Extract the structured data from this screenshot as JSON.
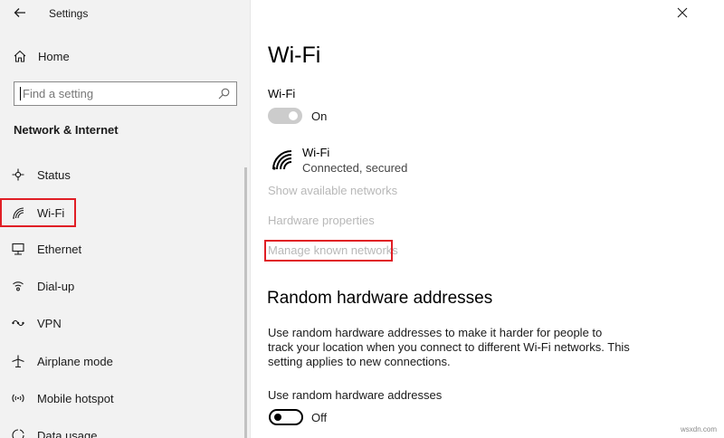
{
  "window": {
    "title": "Settings"
  },
  "sidebar": {
    "home_label": "Home",
    "search_placeholder": "Find a setting",
    "section_title": "Network & Internet",
    "items": [
      {
        "label": "Status",
        "icon": "status-icon"
      },
      {
        "label": "Wi-Fi",
        "icon": "wifi-icon",
        "selected": true
      },
      {
        "label": "Ethernet",
        "icon": "ethernet-icon"
      },
      {
        "label": "Dial-up",
        "icon": "dialup-icon"
      },
      {
        "label": "VPN",
        "icon": "vpn-icon"
      },
      {
        "label": "Airplane mode",
        "icon": "airplane-icon"
      },
      {
        "label": "Mobile hotspot",
        "icon": "hotspot-icon"
      },
      {
        "label": "Data usage",
        "icon": "data-usage-icon"
      }
    ]
  },
  "main": {
    "page_title": "Wi-Fi",
    "wifi_toggle": {
      "label": "Wi-Fi",
      "state": "On",
      "on": true
    },
    "network": {
      "name": "Wi-Fi",
      "status": "Connected, secured"
    },
    "links": {
      "show_available": "Show available networks",
      "hardware_properties": "Hardware properties",
      "manage_known": "Manage known networks"
    },
    "random_hw": {
      "heading": "Random hardware addresses",
      "description": "Use random hardware addresses to make it harder for people to track your location when you connect to different Wi-Fi networks. This setting applies to new connections.",
      "setting_label": "Use random hardware addresses",
      "state": "Off",
      "on": false
    }
  },
  "colors": {
    "highlight_box": "#e01e25",
    "sidebar_bg": "#f2f2f2",
    "link_disabled": "#b8b8b8"
  },
  "watermark": "wsxdn.com"
}
